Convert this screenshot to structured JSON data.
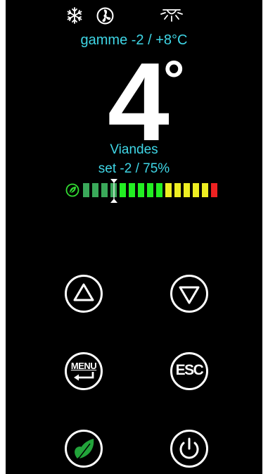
{
  "status": {
    "icons": [
      "snowflake-icon",
      "fan-icon",
      "light-icon"
    ]
  },
  "display": {
    "range_text": "gamme -2 / +8°C",
    "temperature": "4",
    "degree_symbol": "°",
    "mode": "Viandes",
    "setpoint": "set -2 / 75%"
  },
  "bar": {
    "leaf_icon": "leaf-icon",
    "segment_colors": [
      "#3aa95a",
      "#3aa95a",
      "#3aa95a",
      "#3aa95a",
      "#22ee22",
      "#22ee22",
      "#22ee22",
      "#22ee22",
      "#22ee22",
      "#eeee22",
      "#eeee22",
      "#eeee22",
      "#eeee22",
      "#eeee22",
      "#ee2222"
    ],
    "marker_index": 3
  },
  "buttons": {
    "up": "up-button",
    "down": "down-button",
    "menu_label": "MENU",
    "esc_label": "ESC",
    "eco": "eco-button",
    "power": "power-button"
  },
  "colors": {
    "accent": "#3fd6e6",
    "eco_green": "#22a33a"
  }
}
